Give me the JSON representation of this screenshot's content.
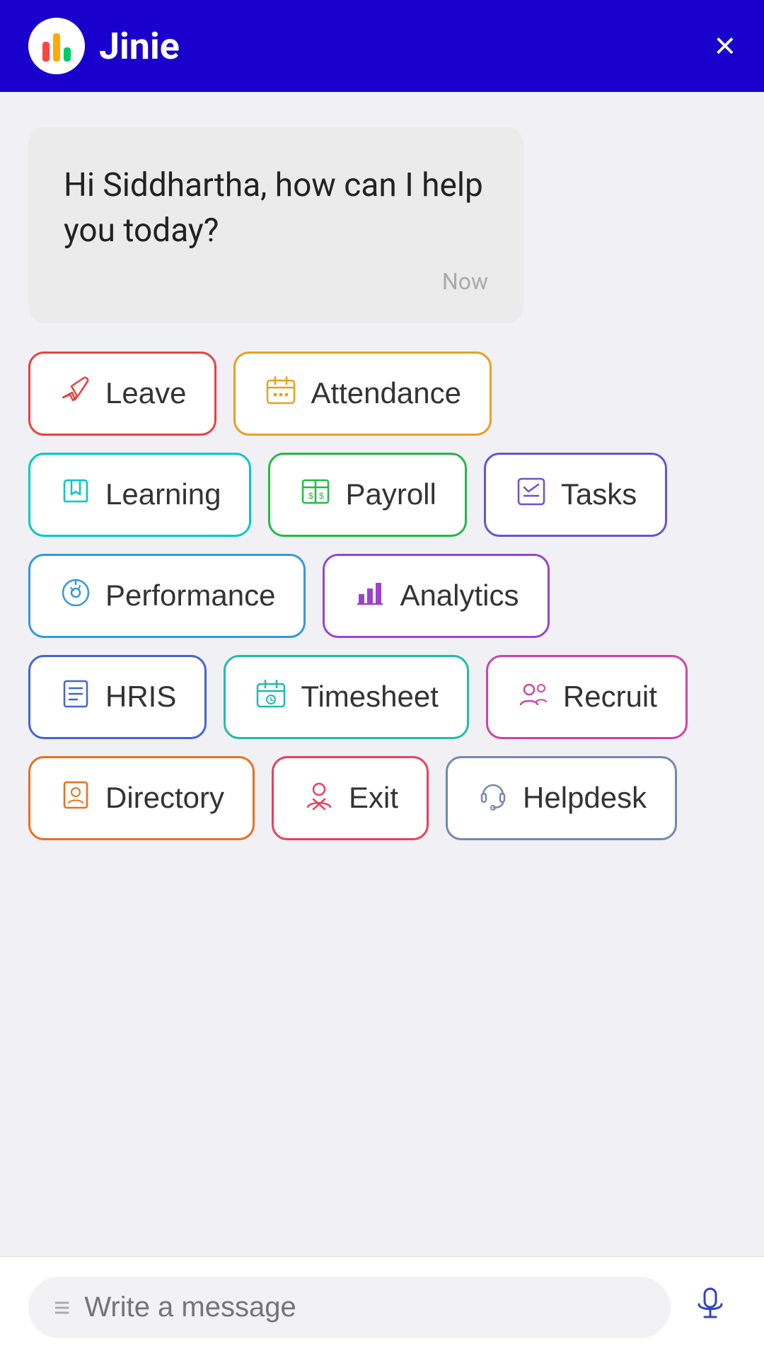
{
  "header": {
    "title": "Jinie",
    "close_label": "×"
  },
  "message": {
    "text": "Hi Siddhartha, how can I help you today?",
    "time": "Now"
  },
  "buttons": [
    {
      "id": "leave",
      "label": "Leave",
      "class": "btn-leave",
      "icon": "✈"
    },
    {
      "id": "attendance",
      "label": "Attendance",
      "class": "btn-attendance",
      "icon": "📅"
    },
    {
      "id": "learning",
      "label": "Learning",
      "class": "btn-learning",
      "icon": "📖"
    },
    {
      "id": "payroll",
      "label": "Payroll",
      "class": "btn-payroll",
      "icon": "💵"
    },
    {
      "id": "tasks",
      "label": "Tasks",
      "class": "btn-tasks",
      "icon": "☑"
    },
    {
      "id": "performance",
      "label": "Performance",
      "class": "btn-performance",
      "icon": "🎯"
    },
    {
      "id": "analytics",
      "label": "Analytics",
      "class": "btn-analytics",
      "icon": "📊"
    },
    {
      "id": "hris",
      "label": "HRIS",
      "class": "btn-hris",
      "icon": "📄"
    },
    {
      "id": "timesheet",
      "label": "Timesheet",
      "class": "btn-timesheet",
      "icon": "🗓"
    },
    {
      "id": "recruit",
      "label": "Recruit",
      "class": "btn-recruit",
      "icon": "👥"
    },
    {
      "id": "directory",
      "label": "Directory",
      "class": "btn-directory",
      "icon": "📇"
    },
    {
      "id": "exit",
      "label": "Exit",
      "class": "btn-exit",
      "icon": "🚶"
    },
    {
      "id": "helpdesk",
      "label": "Helpdesk",
      "class": "btn-helpdesk",
      "icon": "🎧"
    }
  ],
  "input": {
    "placeholder": "Write a message"
  }
}
